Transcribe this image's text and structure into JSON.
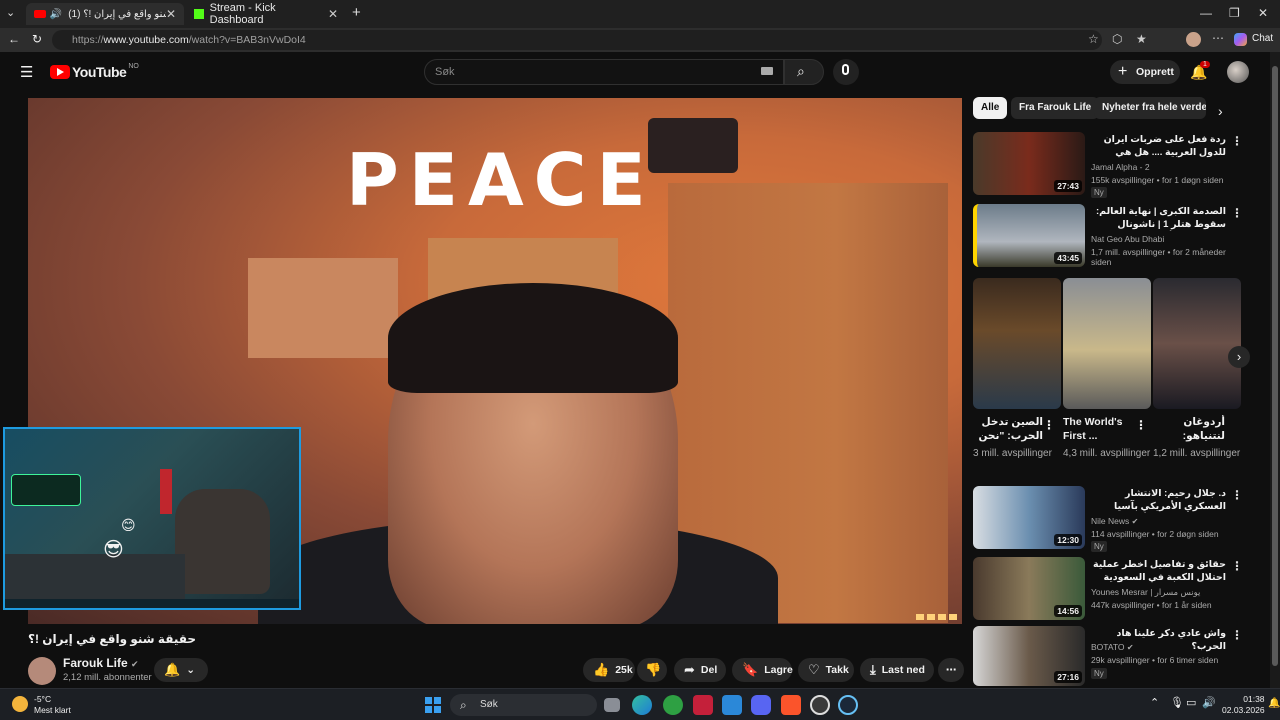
{
  "browser": {
    "tabs": [
      {
        "title": "(1) حقيقة شنو واقع في إيران !؟"
      },
      {
        "title": "Stream - Kick Dashboard"
      }
    ],
    "url_prefix": "https://",
    "url_host": "www.youtube.com",
    "url_path": "/watch?v=BAB3nVwDoI4",
    "chat_label": "Chat"
  },
  "youtube": {
    "logo": "YouTube",
    "region": "NO",
    "search_placeholder": "Søk",
    "create_label": "Opprett",
    "notification_count": "1"
  },
  "video": {
    "overlay_text": "PEACE",
    "title": "حقيقة شنو واقع في إيران !؟",
    "channel": "Farouk Life",
    "subscribers": "2,12 mill. abonnenter",
    "likes": "25k",
    "share_label": "Del",
    "save_label": "Lagre",
    "thanks_label": "Takk",
    "download_label": "Last ned"
  },
  "sidebar": {
    "chips": [
      "Alle",
      "Fra Farouk Life",
      "Nyheter fra hele verden"
    ],
    "recs": [
      {
        "title": "ردة فعل على ضربات ايران للدول العربية .... هل هي بداية النهاية ؟",
        "channel": "Jamal Alpha - 2",
        "meta": "155k avspillinger • for 1 døgn siden",
        "duration": "27:43",
        "badge": "Ny"
      },
      {
        "title": "الصدمة الكبرى | نهاية العالم: سقوط هتلر 1 | ناشونال جيوغرافيك أبوظبي",
        "channel": "Nat Geo Abu Dhabi",
        "meta": "1,7 mill. avspillinger • for 2 måneder siden",
        "duration": "43:45",
        "badge": ""
      }
    ],
    "shorts": [
      {
        "title": "الصين تدخل الحرب: \"نحن ...",
        "views": "3 mill. avspillinger"
      },
      {
        "title": "The World's First ...",
        "views": "4,3 mill. avspillinger"
      },
      {
        "title": "أردوغان لنتنياهو: ساعة نهايتك ...",
        "views": "1,2 mill. avspillinger"
      }
    ],
    "recs2": [
      {
        "title": "د. جلال رحيم: الانتشار العسكري الأمريكي بآسيا والمحيط الهادئ يأتي في إطار الحرب...",
        "channel": "Nile News",
        "meta": "114 avspillinger • for 2 døgn siden",
        "duration": "12:30",
        "badge": "Ny"
      },
      {
        "title": "حقائق و تفاصيل اخطر عملية احتلال الكعبة في السعودية من طرف المهدي المنتظر",
        "channel": "Younes Mesrar | يونس مسرار",
        "meta": "447k avspillinger • for 1 år siden",
        "duration": "14:56",
        "badge": ""
      },
      {
        "title": "واش عادي دكر علينا هاد الحرب؟",
        "channel": "BOTATO",
        "meta": "29k avspillinger • for 6 timer siden",
        "duration": "27:16",
        "badge": "Ny"
      }
    ]
  },
  "taskbar": {
    "weather_temp": "-5°C",
    "weather_desc": "Mest klart",
    "search_label": "Søk",
    "time": "01:38",
    "date": "02.03.2026"
  }
}
